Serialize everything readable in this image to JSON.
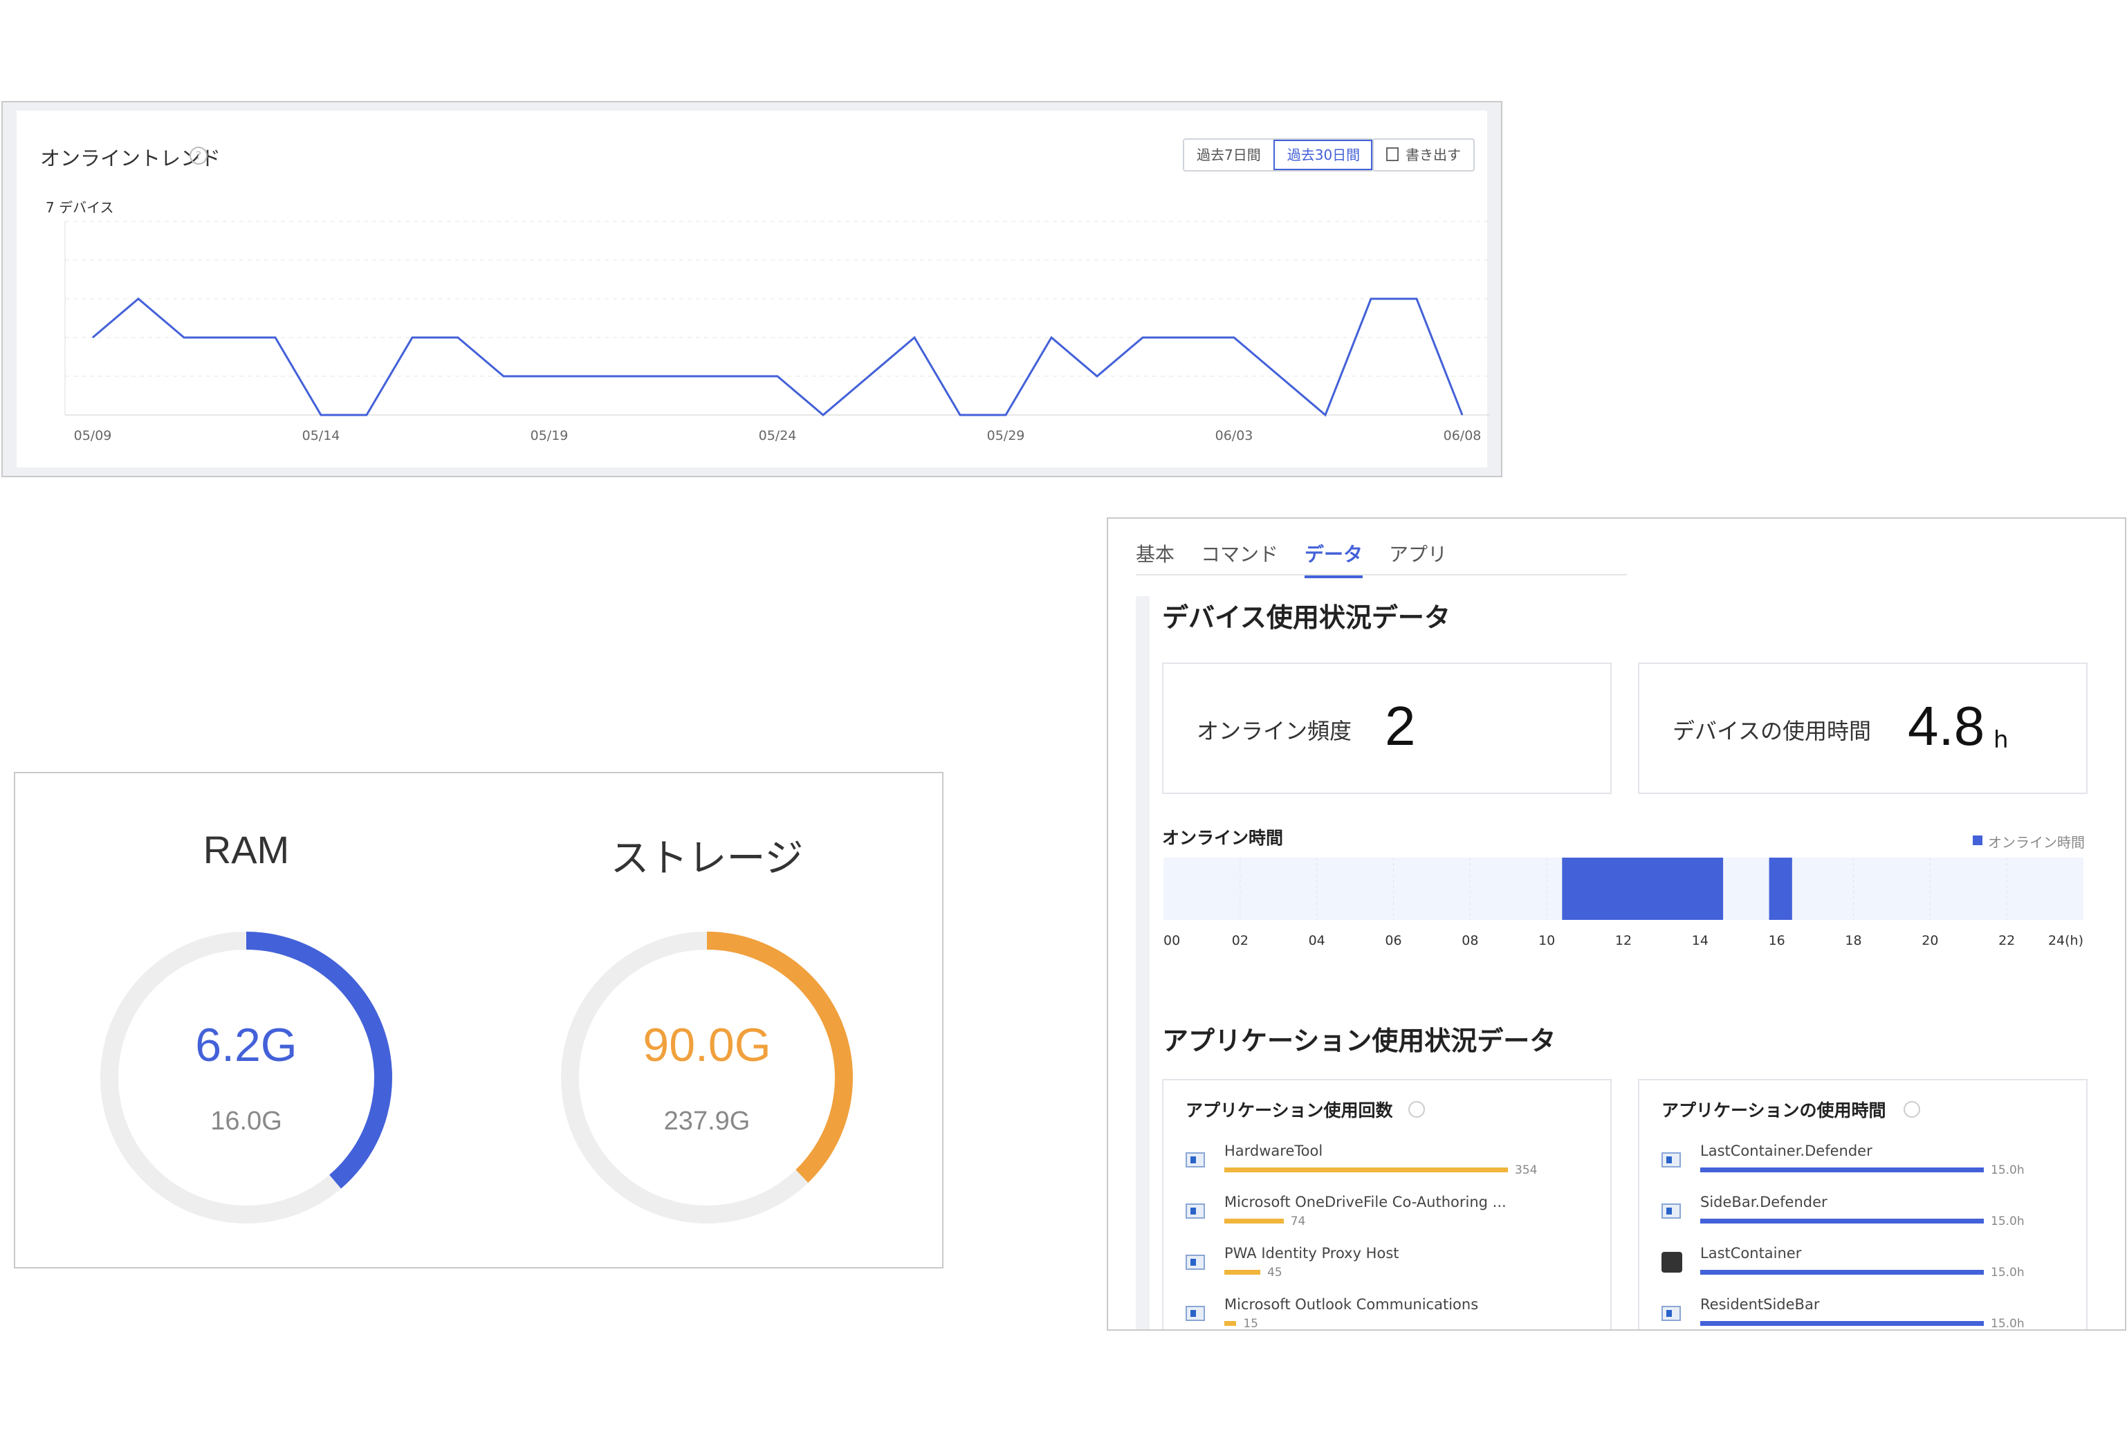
{
  "trend": {
    "title": "オンライントレンド",
    "help_glyph": "?",
    "range_buttons": [
      "過去7日間",
      "過去30日間"
    ],
    "active_range": "過去30日間",
    "export_label": "書き出す",
    "y_label": "7 デバイス",
    "x_ticks": [
      "05/09",
      "05/14",
      "05/19",
      "05/24",
      "05/29",
      "06/03",
      "06/08"
    ]
  },
  "chart_data": {
    "type": "line",
    "title": "オンライントレンド",
    "xlabel": "",
    "ylabel": "7 デバイス",
    "ylim": [
      0,
      5
    ],
    "grid": true,
    "x": [
      "05/09",
      "05/10",
      "05/11",
      "05/12",
      "05/13",
      "05/14",
      "05/15",
      "05/16",
      "05/17",
      "05/18",
      "05/19",
      "05/20",
      "05/21",
      "05/22",
      "05/23",
      "05/24",
      "05/25",
      "05/26",
      "05/27",
      "05/28",
      "05/29",
      "05/30",
      "05/31",
      "06/01",
      "06/02",
      "06/03",
      "06/04",
      "06/05",
      "06/06",
      "06/07",
      "06/08"
    ],
    "series": [
      {
        "color": "#4361d8",
        "values": [
          2,
          3,
          2,
          2,
          2,
          0,
          0,
          2,
          2,
          1,
          1,
          1,
          1,
          1,
          1,
          1,
          0,
          1,
          2,
          0,
          0,
          2,
          1,
          2,
          2,
          2,
          1,
          0,
          3,
          3,
          0
        ]
      }
    ]
  },
  "resources": {
    "ram": {
      "title": "RAM",
      "used": "6.2G",
      "total": "16.0G",
      "fraction": 0.3875,
      "color": "#4361d8"
    },
    "storage": {
      "title": "ストレージ",
      "used": "90.0G",
      "total": "237.9G",
      "fraction": 0.378,
      "color": "#f0a03c"
    }
  },
  "data_panel": {
    "tabs": [
      "基本",
      "コマンド",
      "データ",
      "アプリ"
    ],
    "active_tab": "データ",
    "device_section_title": "デバイス使用状況データ",
    "online_freq": {
      "label": "オンライン頻度",
      "value": "2"
    },
    "usage_time": {
      "label": "デバイスの使用時間",
      "value": "4.8",
      "unit": "h"
    },
    "online_time": {
      "title": "オンライン時間",
      "legend": "オンライン時間",
      "hour_ticks": [
        "00",
        "02",
        "04",
        "06",
        "08",
        "10",
        "12",
        "14",
        "16",
        "18",
        "20",
        "22",
        "24(h)"
      ],
      "intervals": [
        [
          10.4,
          14.6
        ],
        [
          15.8,
          16.4
        ]
      ],
      "color": "#4361d8"
    },
    "app_section_title": "アプリケーション使用状況データ",
    "app_counts": {
      "title": "アプリケーション使用回数",
      "color": "#f0b53a",
      "max": 354,
      "items": [
        {
          "name": "HardwareTool",
          "value": 354,
          "label": "354"
        },
        {
          "name": "Microsoft OneDriveFile Co-Authoring ...",
          "value": 74,
          "label": "74"
        },
        {
          "name": "PWA Identity Proxy Host",
          "value": 45,
          "label": "45"
        },
        {
          "name": "Microsoft Outlook Communications",
          "value": 15,
          "label": "15"
        }
      ]
    },
    "app_time": {
      "title": "アプリケーションの使用時間",
      "color": "#4361d8",
      "max": 15.0,
      "items": [
        {
          "name": "LastContainer.Defender",
          "value": 15.0,
          "label": "15.0h",
          "icon": "window-icon"
        },
        {
          "name": "SideBar.Defender",
          "value": 15.0,
          "label": "15.0h",
          "icon": "window-icon"
        },
        {
          "name": "LastContainer",
          "value": 15.0,
          "label": "15.0h",
          "icon": "home-icon"
        },
        {
          "name": "ResidentSideBar",
          "value": 15.0,
          "label": "15.0h",
          "icon": "window-icon"
        }
      ]
    }
  }
}
